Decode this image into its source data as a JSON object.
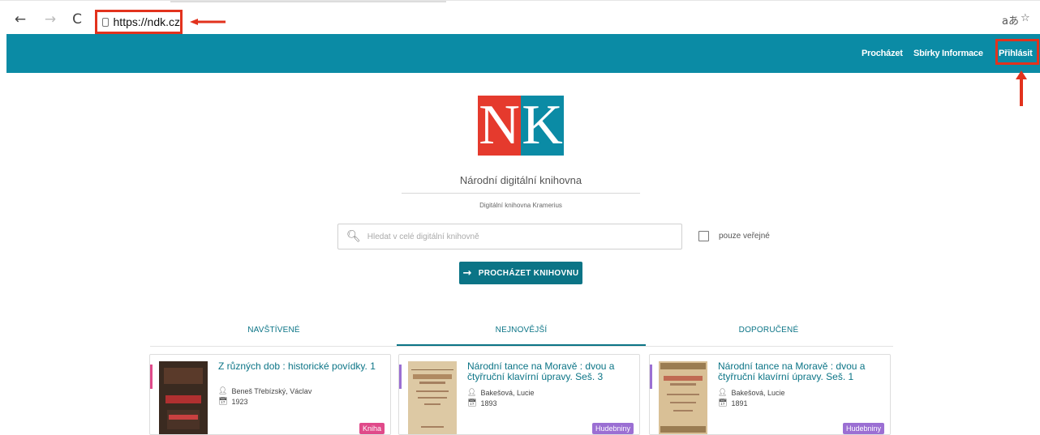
{
  "browser": {
    "url": "https://ndk.cz",
    "back_icon": "←",
    "forward_icon": "→",
    "reload_icon": "C",
    "right_icons": [
      "aあ",
      "☆"
    ]
  },
  "nav": {
    "items": [
      "Procházet",
      "Sbírky",
      "Informace",
      "Přihlásit"
    ]
  },
  "logo": {
    "left": "N",
    "right": "K"
  },
  "hero": {
    "title": "Národní digitální knihovna",
    "subtitle": "Digitální knihovna Kramerius"
  },
  "search": {
    "placeholder": "Hledat v celé digitální knihovně",
    "checkbox_label": "pouze veřejné"
  },
  "browse_button": "PROCHÁZET KNIHOVNU",
  "tabs": [
    "NAVŠTÍVENÉ",
    "NEJNOVĚJŠÍ",
    "DOPORUČENÉ"
  ],
  "cards": [
    {
      "title": "Z různých dob : historické povídky. 1",
      "author": "Beneš Třebízský, Václav",
      "year": "1923",
      "badge": "Kniha",
      "badge_color": "#e04a8a",
      "accent_color": "#e04a8a"
    },
    {
      "title": "Národní tance na Moravě : dvou a čtyřruční klavírní úpravy. Seš. 3",
      "author": "Bakešová, Lucie",
      "year": "1893",
      "badge": "Hudebniny",
      "badge_color": "#9b6fd3",
      "accent_color": "#9b6fd3"
    },
    {
      "title": "Národní tance na Moravě : dvou a čtyřruční klavírní úpravy. Seš. 1",
      "author": "Bakešová, Lucie",
      "year": "1891",
      "badge": "Hudebniny",
      "badge_color": "#9b6fd3",
      "accent_color": "#9b6fd3"
    }
  ],
  "colors": {
    "accent": "#0b8ba5",
    "highlight": "#e2321d",
    "logo_red": "#e53a2d"
  }
}
